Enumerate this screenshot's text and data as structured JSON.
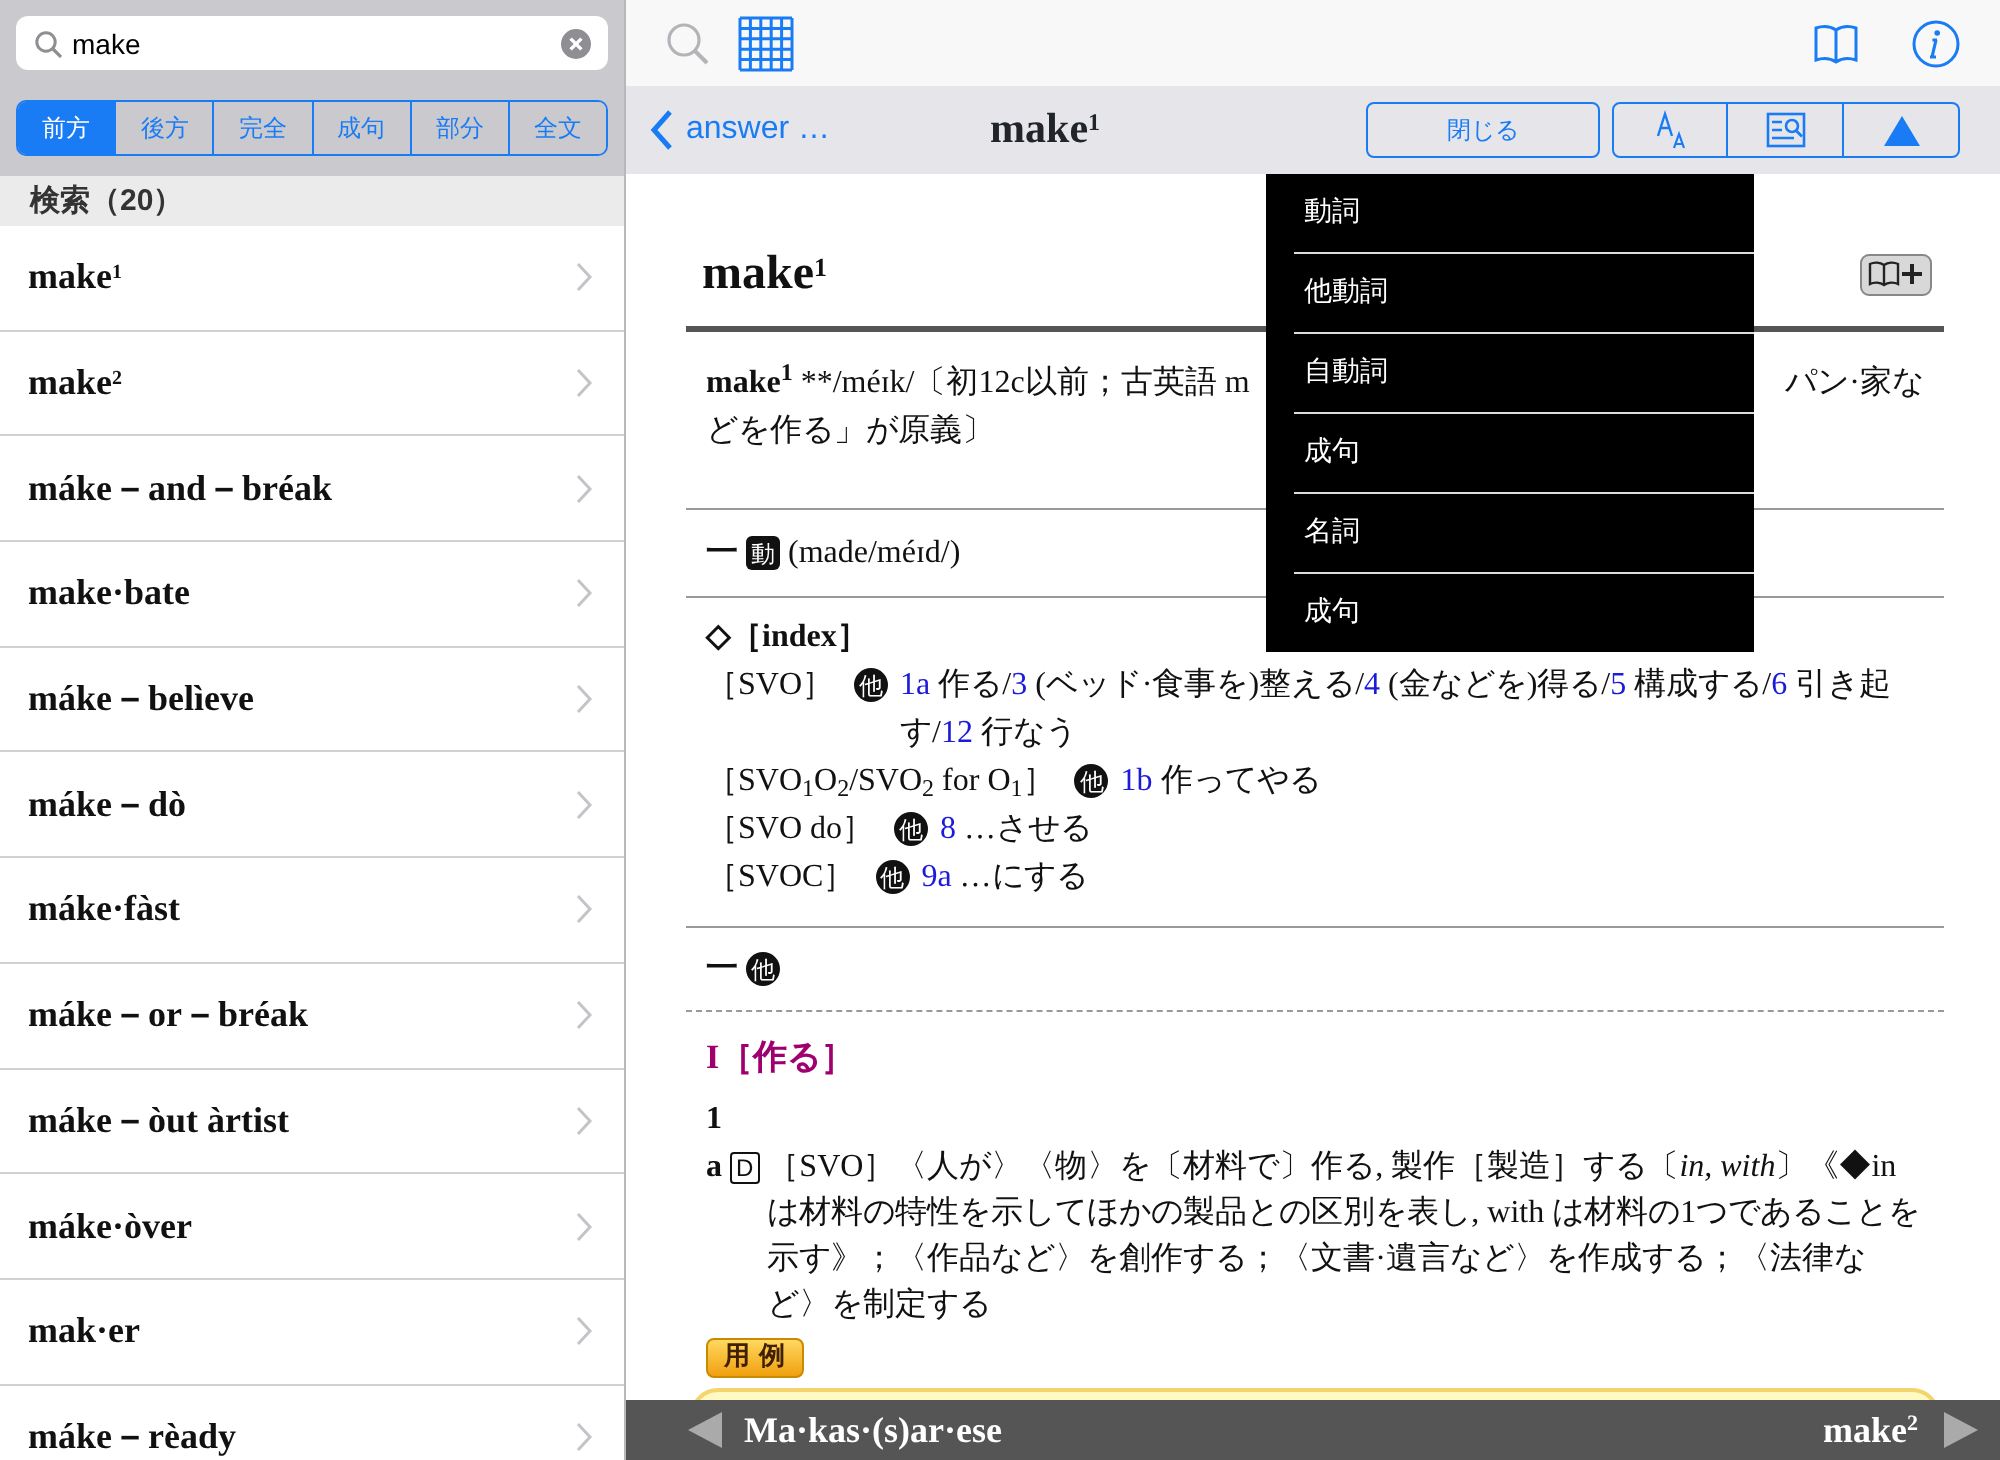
{
  "search": {
    "value": "make"
  },
  "search_modes": [
    {
      "label": "前方",
      "selected": true
    },
    {
      "label": "後方",
      "selected": false
    },
    {
      "label": "完全",
      "selected": false
    },
    {
      "label": "成句",
      "selected": false
    },
    {
      "label": "部分",
      "selected": false
    },
    {
      "label": "全文",
      "selected": false
    }
  ],
  "results_header": "検索（20）",
  "results": [
    "make$^{1}$",
    "make$^{2}$",
    "máke－and－bréak",
    "make·bate",
    "máke－belìeve",
    "máke－dò",
    "máke·fàst",
    "máke－or－bréak",
    "máke－òut àrtist",
    "máke·òver",
    "mak·er",
    "máke－rèady"
  ],
  "nav": {
    "back": "answer …",
    "title": "make$^{1}$",
    "close": "閉じる"
  },
  "menu": [
    "動詞",
    "他動詞",
    "自動詞",
    "成句",
    "名詞",
    "成句"
  ],
  "entry": {
    "headword": "make$^{1}$",
    "etymology_head": "make$^{1}$",
    "etymology_left": " **/méɪk/〔初12c以前；古英語 m",
    "etymology_right": "パン·家な",
    "etymology_line2": "どを作る」が原義〕",
    "verb_section": {
      "dash": "一",
      "badge": "動",
      "text": "(made/méɪd/)"
    },
    "index_title": "◇［index］",
    "index_lines": [
      {
        "pattern": "［SVO］",
        "badge": "他",
        "parts": [
          {
            "kind": "ref",
            "text": "1a"
          },
          {
            "kind": "plain",
            "text": " 作る/"
          },
          {
            "kind": "ref",
            "text": "3"
          },
          {
            "kind": "plain",
            "text": " (ベッド·食事を)整える/"
          },
          {
            "kind": "ref",
            "text": "4"
          },
          {
            "kind": "plain",
            "text": " (金などを)得る/"
          },
          {
            "kind": "ref",
            "text": "5"
          },
          {
            "kind": "plain",
            "text": " 構成する/"
          },
          {
            "kind": "ref",
            "text": "6"
          },
          {
            "kind": "plain",
            "text": " 引き起す/"
          },
          {
            "kind": "ref",
            "text": "12"
          },
          {
            "kind": "plain",
            "text": " 行なう"
          }
        ]
      },
      {
        "pattern": "［SVO$_{1}$O$_{2}$/SVO$_{2}$ for O$_{1}$］",
        "badge": "他",
        "parts": [
          {
            "kind": "ref",
            "text": "1b"
          },
          {
            "kind": "plain",
            "text": " 作ってやる"
          }
        ]
      },
      {
        "pattern": "［SVO do］",
        "badge": "他",
        "parts": [
          {
            "kind": "ref",
            "text": "8"
          },
          {
            "kind": "plain",
            "text": " …させる"
          }
        ]
      },
      {
        "pattern": "［SVOC］",
        "badge": "他",
        "parts": [
          {
            "kind": "ref",
            "text": "9a"
          },
          {
            "kind": "plain",
            "text": " …にする"
          }
        ]
      }
    ],
    "transitive_section": {
      "dash": "一",
      "badge": "他"
    },
    "sense_group": "I［作る］",
    "sense_number": "1",
    "sense_letter": "a",
    "grammar_code": "D",
    "definition": "［SVO］〈人が〉〈物〉を〔材料で〕作る, 製作［製造］する〔*in, with*〕《◆in は材料の特性を示してほかの製品との区別を表し, with は材料の1つであることを示す》；〈作品など〉を創作する；〈文書·遺言など〉を作成する；〈法律など〉を制定する",
    "examples_label": "用 例"
  },
  "bottom_bar": {
    "previous": "Ma·kas·(s)ar·ese",
    "next": "make$^{2}$"
  }
}
